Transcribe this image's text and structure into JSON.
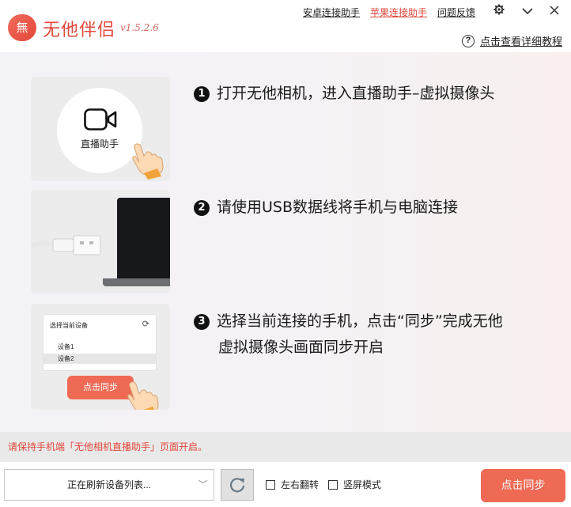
{
  "app": {
    "logo_glyph": "無",
    "name": "无他伴侣",
    "version": "v1.5.2.6"
  },
  "toplinks": [
    {
      "label": "安卓连接助手",
      "active": false
    },
    {
      "label": "苹果连接助手",
      "active": true
    },
    {
      "label": "问题反馈",
      "active": false
    }
  ],
  "window_controls": {
    "settings_icon": "gear-icon",
    "collapse_icon": "chevron-down-icon",
    "close_icon": "close-icon"
  },
  "help": {
    "icon_glyph": "?",
    "label": "点击查看详细教程"
  },
  "steps": {
    "step1": {
      "num": "1",
      "text": "打开无他相机，进入直播助手–虚拟摄像头"
    },
    "step2": {
      "num": "2",
      "text": "请使用USB数据线将手机与电脑连接"
    },
    "step3": {
      "num": "3",
      "line1": "选择当前连接的手机，点击“同步”完成无他",
      "line2": "虚拟摄像头画面同步开启"
    }
  },
  "card1": {
    "label": "直播助手"
  },
  "card3": {
    "panel_title": "选择当前设备",
    "devices": [
      "设备1",
      "设备2"
    ],
    "selected": "设备2",
    "sync_label": "点击同步"
  },
  "notice": "请保持手机端「无他相机直播助手」页面开启。",
  "bottom": {
    "device_select_value": "正在刷新设备列表...",
    "flip_label": "左右翻转",
    "portrait_label": "竖屏模式",
    "sync_label": "点击同步"
  },
  "colors": {
    "accent": "#e2473b",
    "button": "#ee6a55"
  }
}
